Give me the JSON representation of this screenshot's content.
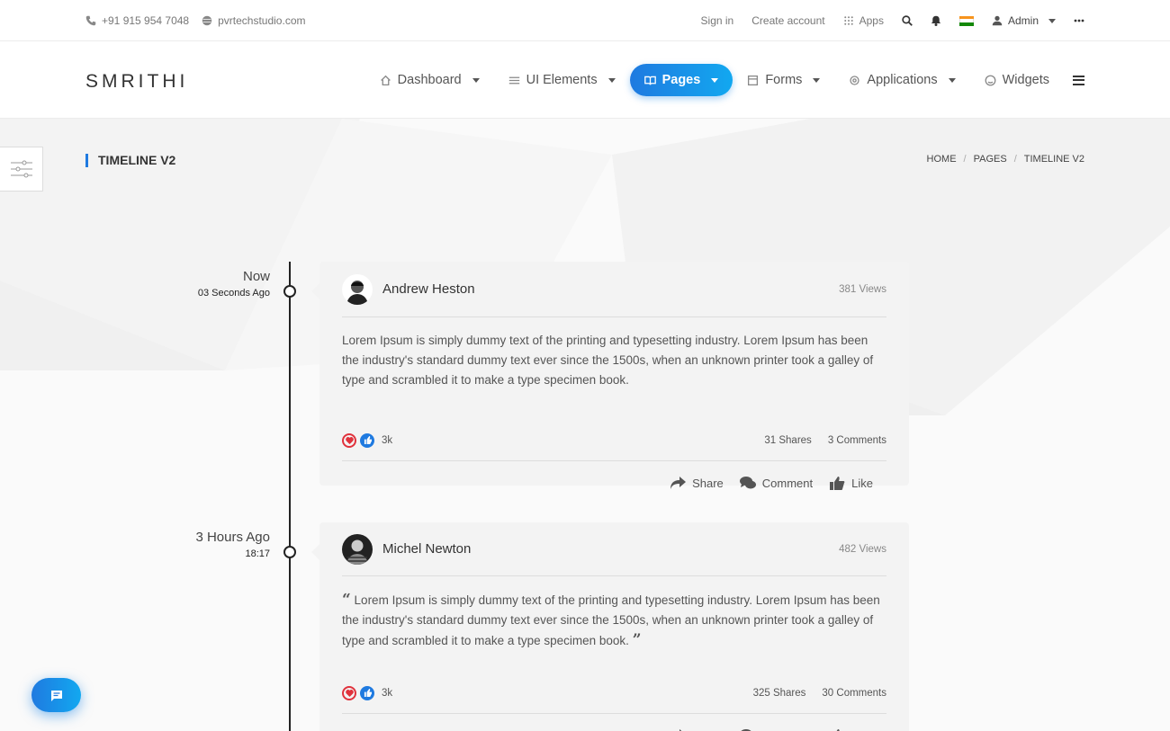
{
  "topbar": {
    "phone": "+91 915 954 7048",
    "website": "pvrtechstudio.com",
    "sign_in": "Sign in",
    "create_account": "Create account",
    "apps": "Apps",
    "user": "Admin"
  },
  "brand": "SMRITHI",
  "nav": {
    "items": [
      {
        "label": "Dashboard",
        "icon": "home-icon"
      },
      {
        "label": "UI Elements",
        "icon": "sliders-icon"
      },
      {
        "label": "Pages",
        "icon": "book-icon",
        "active": true
      },
      {
        "label": "Forms",
        "icon": "form-icon"
      },
      {
        "label": "Applications",
        "icon": "settings-icon"
      },
      {
        "label": "Widgets",
        "icon": "smile-icon"
      }
    ]
  },
  "page": {
    "title": "TIMELINE V2",
    "breadcrumb": [
      "HOME",
      "PAGES",
      "TIMELINE V2"
    ]
  },
  "timeline": [
    {
      "time": "Now",
      "sub": "03 Seconds Ago",
      "author": "Andrew Heston",
      "views": "381 Views",
      "body": "Lorem Ipsum is simply dummy text of the printing and typesetting industry. Lorem Ipsum has been the industry's standard dummy text ever since the 1500s, when an unknown printer took a galley of type and scrambled it to make a type specimen book.",
      "likes": "3k",
      "shares": "31 Shares",
      "comments": "3 Comments"
    },
    {
      "time": "3 Hours Ago",
      "sub": "18:17",
      "author": "Michel Newton",
      "views": "482 Views",
      "body": "Lorem Ipsum is simply dummy text of the printing and typesetting industry. Lorem Ipsum has been the industry's standard dummy text ever since the 1500s, when an unknown printer took a galley of type and scrambled it to make a type specimen book.",
      "likes": "3k",
      "shares": "325 Shares",
      "comments": "30 Comments"
    }
  ],
  "actions": {
    "share": "Share",
    "comment": "Comment",
    "like": "Like"
  },
  "colors": {
    "accent": "#1f7ae0",
    "heart": "#e0323c",
    "thumb": "#1f7ae0"
  }
}
